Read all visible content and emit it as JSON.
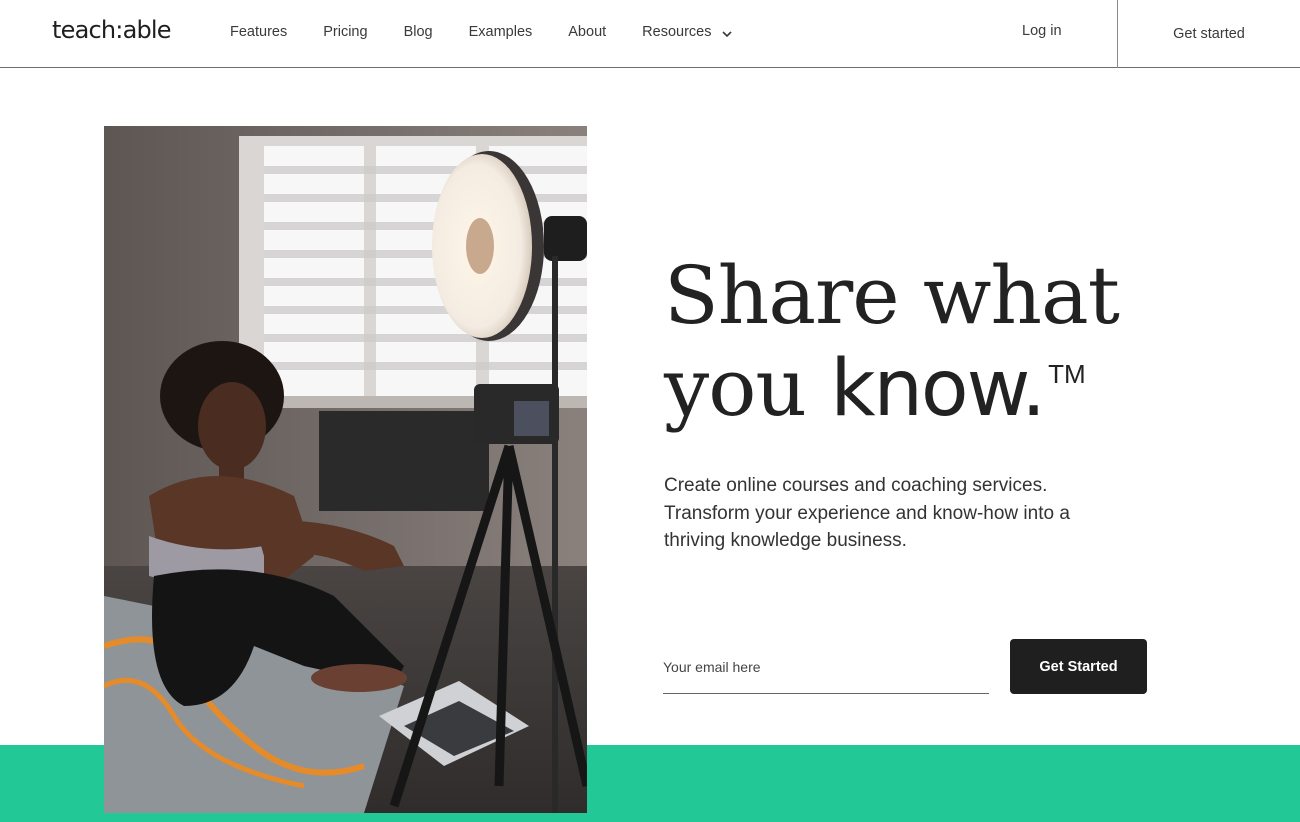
{
  "header": {
    "logo": "teach:able",
    "nav": [
      {
        "label": "Features"
      },
      {
        "label": "Pricing"
      },
      {
        "label": "Blog"
      },
      {
        "label": "Examples"
      },
      {
        "label": "About"
      },
      {
        "label": "Resources",
        "icon": "chevron-down-icon"
      }
    ],
    "login_label": "Log in",
    "get_started_label": "Get started"
  },
  "hero": {
    "headline_line1": "Share what",
    "headline_you": "you ",
    "headline_know": "know.",
    "trademark": "TM",
    "subcopy": "Create online courses and coaching services. Transform your experience and know-how into a thriving knowledge business.",
    "email_placeholder": "Your email here",
    "email_value": "",
    "cta_label": "Get Started",
    "image_alt": "Woman sitting on yoga mat in front of camera on tripod and studio light"
  },
  "colors": {
    "accent_green": "#22c997",
    "cta_bg": "#1f1f1f",
    "text_dark": "#222222"
  }
}
